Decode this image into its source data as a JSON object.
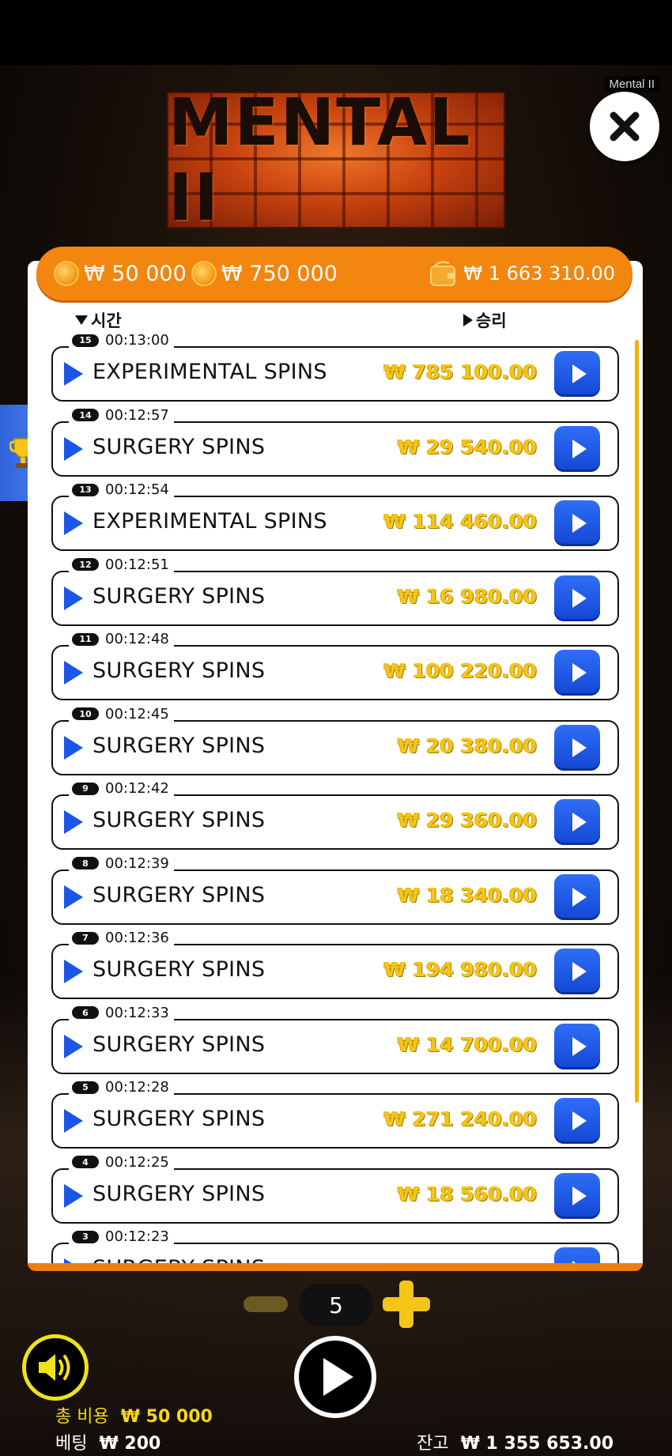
{
  "game": {
    "title": "Mental II",
    "logo_text": "MENTAL II"
  },
  "header": {
    "stat1": "₩ 50 000",
    "stat2": "₩ 750 000",
    "balance": "₩ 1 663 310.00"
  },
  "columns": {
    "time": "시간",
    "win": "승리"
  },
  "history": [
    {
      "index": "15",
      "time": "00:13:00",
      "label": "EXPERIMENTAL SPINS",
      "win": "₩ 785 100.00"
    },
    {
      "index": "14",
      "time": "00:12:57",
      "label": "SURGERY SPINS",
      "win": "₩ 29 540.00"
    },
    {
      "index": "13",
      "time": "00:12:54",
      "label": "EXPERIMENTAL SPINS",
      "win": "₩ 114 460.00"
    },
    {
      "index": "12",
      "time": "00:12:51",
      "label": "SURGERY SPINS",
      "win": "₩ 16 980.00"
    },
    {
      "index": "11",
      "time": "00:12:48",
      "label": "SURGERY SPINS",
      "win": "₩ 100 220.00"
    },
    {
      "index": "10",
      "time": "00:12:45",
      "label": "SURGERY SPINS",
      "win": "₩ 20 380.00"
    },
    {
      "index": "9",
      "time": "00:12:42",
      "label": "SURGERY SPINS",
      "win": "₩ 29 360.00"
    },
    {
      "index": "8",
      "time": "00:12:39",
      "label": "SURGERY SPINS",
      "win": "₩ 18 340.00"
    },
    {
      "index": "7",
      "time": "00:12:36",
      "label": "SURGERY SPINS",
      "win": "₩ 194 980.00"
    },
    {
      "index": "6",
      "time": "00:12:33",
      "label": "SURGERY SPINS",
      "win": "₩ 14 700.00"
    },
    {
      "index": "5",
      "time": "00:12:28",
      "label": "SURGERY SPINS",
      "win": "₩ 271 240.00"
    },
    {
      "index": "4",
      "time": "00:12:25",
      "label": "SURGERY SPINS",
      "win": "₩ 18 560.00"
    },
    {
      "index": "3",
      "time": "00:12:23",
      "label": "SURGERY SPINS",
      "win": ""
    }
  ],
  "controls": {
    "stepper_value": "5"
  },
  "footer": {
    "total_cost_label": "총 비용",
    "total_cost_value": "₩ 50 000",
    "bet_label": "베팅",
    "bet_value": "₩ 200",
    "balance_label": "잔고",
    "balance_value": "₩ 1 355 653.00"
  },
  "colors": {
    "accent_orange": "#f3860f",
    "button_blue": "#1b56e8",
    "win_gold": "#f5c518",
    "sound_ring": "#f0e21a"
  },
  "icons": [
    "close-icon",
    "trophy-icon",
    "coin-icon",
    "wallet-icon",
    "play-icon",
    "sound-icon",
    "minus-icon",
    "plus-icon"
  ]
}
